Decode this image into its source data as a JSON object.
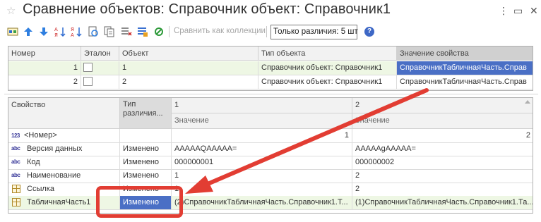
{
  "window": {
    "title": "Сравнение объектов: Справочник объект: Справочник1",
    "favorite_glyph": "☆",
    "more_glyph": "⋮",
    "minimize_glyph": "▭",
    "close_glyph": "✕"
  },
  "toolbar": {
    "compare_collections_label": "Сравнить как коллекции",
    "only_differences_label": "Только различия: 5 шт",
    "help_label": "?"
  },
  "objects_table": {
    "columns": [
      "Номер",
      "Эталон",
      "Объект",
      "Тип объекта",
      "Значение свойства"
    ],
    "rows": [
      {
        "number": "1",
        "object": "1",
        "object_type": "Справочник объект: Справочник1",
        "property_value": "СправочникТабличнаяЧасть.Справ",
        "selected": true
      },
      {
        "number": "2",
        "object": "2",
        "object_type": "Справочник объект: Справочник1",
        "property_value": "СправочникТабличнаяЧасть.Справ"
      }
    ]
  },
  "properties_table": {
    "header": {
      "property": "Свойство",
      "diff_type": "Тип различия...",
      "object1": "1",
      "object2": "2",
      "value1": "Значение",
      "value2": "Значение"
    },
    "rows": [
      {
        "icon": "number-icon",
        "name": "<Номер>",
        "diff": "",
        "v1": "1",
        "v2": "2",
        "align": "right"
      },
      {
        "icon": "string-icon",
        "name": "Версия данных",
        "diff": "Изменено",
        "v1": "AAAAAQAAAAA=",
        "v2": "AAAAAgAAAAA="
      },
      {
        "icon": "string-icon",
        "name": "Код",
        "diff": "Изменено",
        "v1": "000000001",
        "v2": "000000002"
      },
      {
        "icon": "string-icon",
        "name": "Наименование",
        "diff": "Изменено",
        "v1": "1",
        "v2": "2"
      },
      {
        "icon": "table-icon",
        "name": "Ссылка",
        "diff": "Изменено",
        "v1": "1",
        "v2": "2"
      },
      {
        "icon": "table-icon",
        "name": "ТабличнаяЧасть1",
        "diff": "Изменено",
        "v1": "(2)СправочникТабличнаяЧасть.Справочник1.Т...",
        "v2": "(1)СправочникТабличнаяЧасть.Справочник1.Та...",
        "selected": true
      }
    ]
  },
  "icons": {
    "number_icon_text": "123",
    "string_icon_text": "abc"
  },
  "colors": {
    "selection_blue": "#4a6fc5",
    "row_highlight_green": "#eef7e4",
    "annotation_red": "#e23d33"
  }
}
